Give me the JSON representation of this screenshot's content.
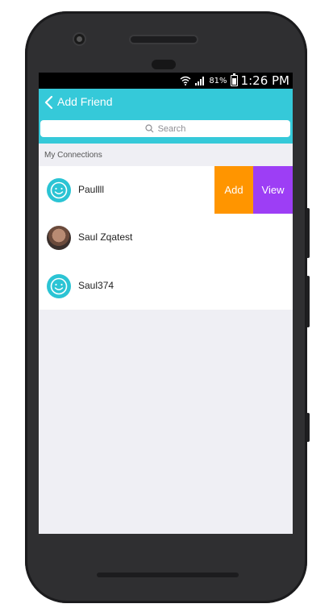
{
  "status_bar": {
    "battery_percent": "81%",
    "time": "1:26 PM"
  },
  "nav": {
    "title": "Add Friend"
  },
  "search": {
    "placeholder": "Search"
  },
  "section": {
    "title": "My Connections"
  },
  "connections": [
    {
      "name": "Paullll",
      "avatar": "smiley-avatar-icon"
    },
    {
      "name": "Saul Zqatest",
      "avatar": "user-photo"
    },
    {
      "name": "Saul374",
      "avatar": "smiley-avatar-icon"
    }
  ],
  "swipe_actions": {
    "add_label": "Add",
    "view_label": "View"
  },
  "colors": {
    "accent": "#35c9d9",
    "add": "#ff9500",
    "view": "#9d3ef5"
  }
}
